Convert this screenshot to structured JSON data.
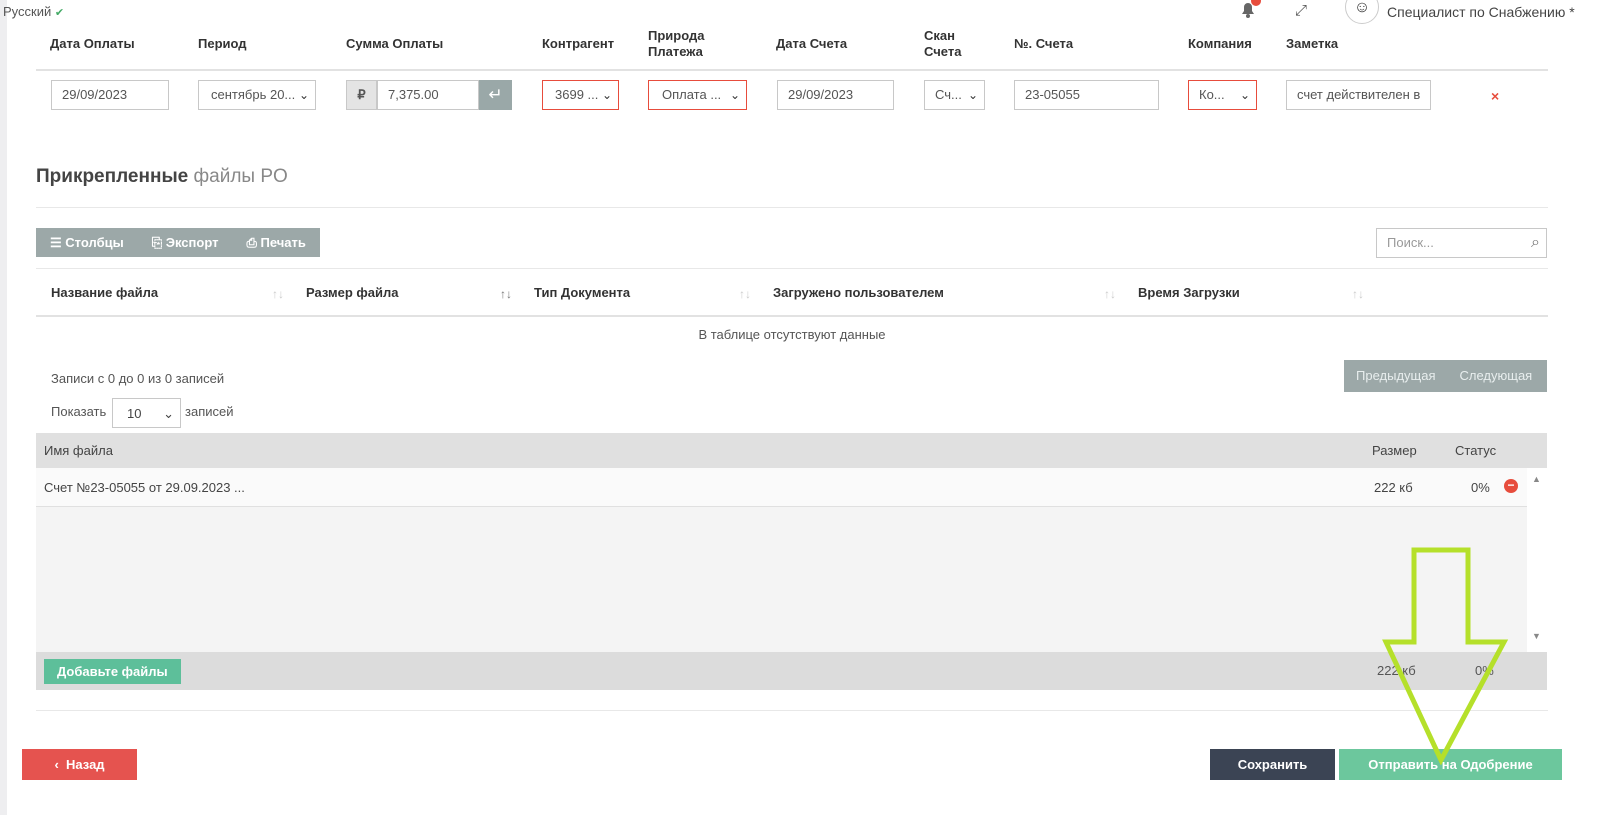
{
  "topbar": {
    "language": "Русский",
    "user_role": "Специалист по Снабжению *"
  },
  "payment_table": {
    "headers": {
      "pay_date": "Дата Оплаты",
      "period": "Период",
      "amount": "Сумма Оплаты",
      "counterparty": "Контрагент",
      "nature_line1": "Природа",
      "nature_line2": "Платежа",
      "invoice_date": "Дата Счета",
      "scan_line1": "Скан",
      "scan_line2": "Счета",
      "invoice_no": "№. Счета",
      "company": "Компания",
      "note": "Заметка"
    },
    "row": {
      "pay_date": "29/09/2023",
      "period": "сентябрь 20...",
      "currency_symbol": "₽",
      "amount": "7,375.00",
      "counterparty": "3699 ...",
      "nature": "Оплата ...",
      "invoice_date": "29/09/2023",
      "scan": "Сч...",
      "invoice_no": "23-05055",
      "company": "Ко...",
      "note": "счет действителен в",
      "delete": "×"
    }
  },
  "attached": {
    "title_bold": "Прикрепленные",
    "title_light": "файлы PO",
    "toolbar": {
      "columns": "Столбцы",
      "export": "Экспорт",
      "print": "Печать"
    },
    "search_placeholder": "Поиск...",
    "columns": [
      "Название файла",
      "Размер файла",
      "Тип Документа",
      "Загружено пользователем",
      "Время Загрузки"
    ],
    "empty_text": "В таблице отсутствуют данные",
    "info": "Записи с 0 до 0 из 0 записей",
    "pager": {
      "prev": "Предыдущая",
      "next": "Следующая"
    },
    "show_label": "Показать",
    "page_size": "10",
    "show_suffix": "записей"
  },
  "uploader": {
    "col_name": "Имя файла",
    "col_size": "Размер",
    "col_status": "Статус",
    "files": [
      {
        "name": "Счет №23-05055 от 29.09.2023 ...",
        "size": "222 кб",
        "status": "0%"
      }
    ],
    "add_button": "Добавьте файлы",
    "total_size": "222 кб",
    "total_status": "0%"
  },
  "actions": {
    "back": "Назад",
    "save": "Сохранить",
    "submit": "Отправить на Одобрение"
  },
  "colors": {
    "danger": "#e5534f",
    "dark": "#3b4454",
    "success": "#6cc79d",
    "arrow": "#b5e02a",
    "toolbar": "#9ca8a8"
  }
}
